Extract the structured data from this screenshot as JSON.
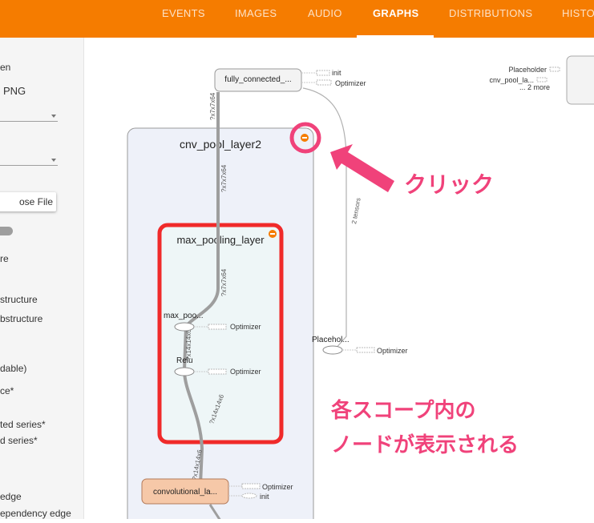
{
  "tabs": [
    {
      "label": "EVENTS",
      "active": false
    },
    {
      "label": "IMAGES",
      "active": false
    },
    {
      "label": "AUDIO",
      "active": false
    },
    {
      "label": "GRAPHS",
      "active": true
    },
    {
      "label": "DISTRIBUTIONS",
      "active": false
    },
    {
      "label": "HISTO",
      "active": false
    }
  ],
  "sidebar": {
    "fit_screen_fragment": "en",
    "download_png_fragment": "PNG",
    "choose_file_button": "ose File",
    "texture_fragment": "re",
    "structure_fragment_1": "structure",
    "structure_fragment_2": "bstructure",
    "expandable_fragment": "dable)",
    "instance_fragment": "ce*",
    "series_fragment_1": "ted series*",
    "series_fragment_2": "d series*",
    "edge_fragment": "edge",
    "dependency_edge_fragment": "ependency edge"
  },
  "graph": {
    "fully_connected_node": "fully_connected_...",
    "fc_aux_init": "init",
    "fc_aux_optimizer": "Optimizer",
    "tr_placeholder": "Placeholder",
    "tr_cnv_pool": "cnv_pool_la...",
    "tr_more": "... 2 more",
    "cnv_pool_layer2": "cnv_pool_layer2",
    "max_pooling_layer": "max_pooling_layer",
    "max_pool_op": "max_poo...",
    "relu_op": "Relu",
    "optimizer_label": "Optimizer",
    "placeholder_node": "Placehol...",
    "convolutional_node": "convolutional_la...",
    "conv_aux_optimizer": "Optimizer",
    "conv_aux_init": "init",
    "edge_label_top": "?x7x7x64",
    "edge_label_1": "?x7x7x64",
    "edge_label_2": "?x7x7x64",
    "edge_label_relu": "?x14x14x6",
    "edge_label_mid": "?x14x14x6",
    "edge_label_low": "?x14x14x6",
    "tensors_label": "2 tensors"
  },
  "annotations": {
    "click_label": "クリック",
    "caption_line1": "各スコープ内の",
    "caption_line2": "ノードが表示される",
    "color": "#f0427a"
  },
  "colors": {
    "topbar": "#f57c00",
    "scope_fill": "#eef1f9",
    "max_pool_fill": "#eef6f7",
    "conv_node_fill": "#f6c8a8",
    "highlight_box": "#f02a2a",
    "expand_button": "#f57c00"
  }
}
